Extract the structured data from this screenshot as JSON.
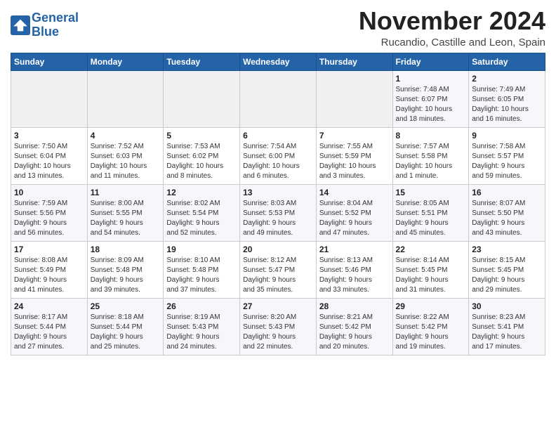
{
  "logo": {
    "line1": "General",
    "line2": "Blue"
  },
  "title": "November 2024",
  "location": "Rucandio, Castille and Leon, Spain",
  "headers": [
    "Sunday",
    "Monday",
    "Tuesday",
    "Wednesday",
    "Thursday",
    "Friday",
    "Saturday"
  ],
  "weeks": [
    [
      {
        "day": "",
        "info": ""
      },
      {
        "day": "",
        "info": ""
      },
      {
        "day": "",
        "info": ""
      },
      {
        "day": "",
        "info": ""
      },
      {
        "day": "",
        "info": ""
      },
      {
        "day": "1",
        "info": "Sunrise: 7:48 AM\nSunset: 6:07 PM\nDaylight: 10 hours\nand 18 minutes."
      },
      {
        "day": "2",
        "info": "Sunrise: 7:49 AM\nSunset: 6:05 PM\nDaylight: 10 hours\nand 16 minutes."
      }
    ],
    [
      {
        "day": "3",
        "info": "Sunrise: 7:50 AM\nSunset: 6:04 PM\nDaylight: 10 hours\nand 13 minutes."
      },
      {
        "day": "4",
        "info": "Sunrise: 7:52 AM\nSunset: 6:03 PM\nDaylight: 10 hours\nand 11 minutes."
      },
      {
        "day": "5",
        "info": "Sunrise: 7:53 AM\nSunset: 6:02 PM\nDaylight: 10 hours\nand 8 minutes."
      },
      {
        "day": "6",
        "info": "Sunrise: 7:54 AM\nSunset: 6:00 PM\nDaylight: 10 hours\nand 6 minutes."
      },
      {
        "day": "7",
        "info": "Sunrise: 7:55 AM\nSunset: 5:59 PM\nDaylight: 10 hours\nand 3 minutes."
      },
      {
        "day": "8",
        "info": "Sunrise: 7:57 AM\nSunset: 5:58 PM\nDaylight: 10 hours\nand 1 minute."
      },
      {
        "day": "9",
        "info": "Sunrise: 7:58 AM\nSunset: 5:57 PM\nDaylight: 9 hours\nand 59 minutes."
      }
    ],
    [
      {
        "day": "10",
        "info": "Sunrise: 7:59 AM\nSunset: 5:56 PM\nDaylight: 9 hours\nand 56 minutes."
      },
      {
        "day": "11",
        "info": "Sunrise: 8:00 AM\nSunset: 5:55 PM\nDaylight: 9 hours\nand 54 minutes."
      },
      {
        "day": "12",
        "info": "Sunrise: 8:02 AM\nSunset: 5:54 PM\nDaylight: 9 hours\nand 52 minutes."
      },
      {
        "day": "13",
        "info": "Sunrise: 8:03 AM\nSunset: 5:53 PM\nDaylight: 9 hours\nand 49 minutes."
      },
      {
        "day": "14",
        "info": "Sunrise: 8:04 AM\nSunset: 5:52 PM\nDaylight: 9 hours\nand 47 minutes."
      },
      {
        "day": "15",
        "info": "Sunrise: 8:05 AM\nSunset: 5:51 PM\nDaylight: 9 hours\nand 45 minutes."
      },
      {
        "day": "16",
        "info": "Sunrise: 8:07 AM\nSunset: 5:50 PM\nDaylight: 9 hours\nand 43 minutes."
      }
    ],
    [
      {
        "day": "17",
        "info": "Sunrise: 8:08 AM\nSunset: 5:49 PM\nDaylight: 9 hours\nand 41 minutes."
      },
      {
        "day": "18",
        "info": "Sunrise: 8:09 AM\nSunset: 5:48 PM\nDaylight: 9 hours\nand 39 minutes."
      },
      {
        "day": "19",
        "info": "Sunrise: 8:10 AM\nSunset: 5:48 PM\nDaylight: 9 hours\nand 37 minutes."
      },
      {
        "day": "20",
        "info": "Sunrise: 8:12 AM\nSunset: 5:47 PM\nDaylight: 9 hours\nand 35 minutes."
      },
      {
        "day": "21",
        "info": "Sunrise: 8:13 AM\nSunset: 5:46 PM\nDaylight: 9 hours\nand 33 minutes."
      },
      {
        "day": "22",
        "info": "Sunrise: 8:14 AM\nSunset: 5:45 PM\nDaylight: 9 hours\nand 31 minutes."
      },
      {
        "day": "23",
        "info": "Sunrise: 8:15 AM\nSunset: 5:45 PM\nDaylight: 9 hours\nand 29 minutes."
      }
    ],
    [
      {
        "day": "24",
        "info": "Sunrise: 8:17 AM\nSunset: 5:44 PM\nDaylight: 9 hours\nand 27 minutes."
      },
      {
        "day": "25",
        "info": "Sunrise: 8:18 AM\nSunset: 5:44 PM\nDaylight: 9 hours\nand 25 minutes."
      },
      {
        "day": "26",
        "info": "Sunrise: 8:19 AM\nSunset: 5:43 PM\nDaylight: 9 hours\nand 24 minutes."
      },
      {
        "day": "27",
        "info": "Sunrise: 8:20 AM\nSunset: 5:43 PM\nDaylight: 9 hours\nand 22 minutes."
      },
      {
        "day": "28",
        "info": "Sunrise: 8:21 AM\nSunset: 5:42 PM\nDaylight: 9 hours\nand 20 minutes."
      },
      {
        "day": "29",
        "info": "Sunrise: 8:22 AM\nSunset: 5:42 PM\nDaylight: 9 hours\nand 19 minutes."
      },
      {
        "day": "30",
        "info": "Sunrise: 8:23 AM\nSunset: 5:41 PM\nDaylight: 9 hours\nand 17 minutes."
      }
    ]
  ]
}
